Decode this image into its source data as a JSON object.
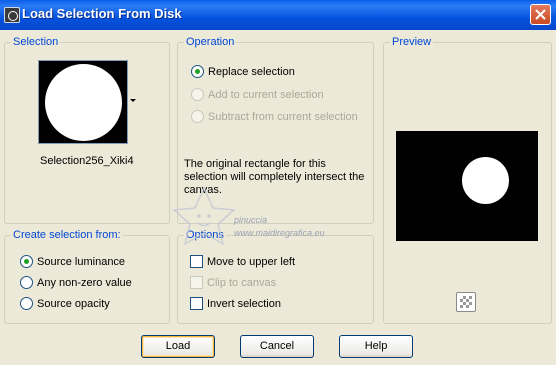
{
  "window": {
    "title": "Load Selection From Disk"
  },
  "selection": {
    "legend": "Selection",
    "name": "Selection256_Xiki4"
  },
  "operation": {
    "legend": "Operation",
    "options": [
      {
        "label": "Replace selection",
        "checked": true,
        "enabled": true
      },
      {
        "label": "Add to current selection",
        "checked": false,
        "enabled": false
      },
      {
        "label": "Subtract from current selection",
        "checked": false,
        "enabled": false
      }
    ],
    "info": "The original rectangle for this selection will completely intersect the canvas."
  },
  "preview": {
    "legend": "Preview"
  },
  "create_from": {
    "legend": "Create selection from:",
    "options": [
      {
        "label": "Source luminance",
        "checked": true
      },
      {
        "label": "Any non-zero value",
        "checked": false
      },
      {
        "label": "Source opacity",
        "checked": false
      }
    ]
  },
  "options": {
    "legend": "Options",
    "items": [
      {
        "label": "Move to upper left",
        "checked": false,
        "enabled": true
      },
      {
        "label": "Clip to canvas",
        "checked": false,
        "enabled": false
      },
      {
        "label": "Invert selection",
        "checked": false,
        "enabled": true
      }
    ]
  },
  "buttons": {
    "load": "Load",
    "cancel": "Cancel",
    "help": "Help"
  },
  "watermark": {
    "line1": "pinuccia",
    "line2": "www.maidiregrafica.eu"
  }
}
